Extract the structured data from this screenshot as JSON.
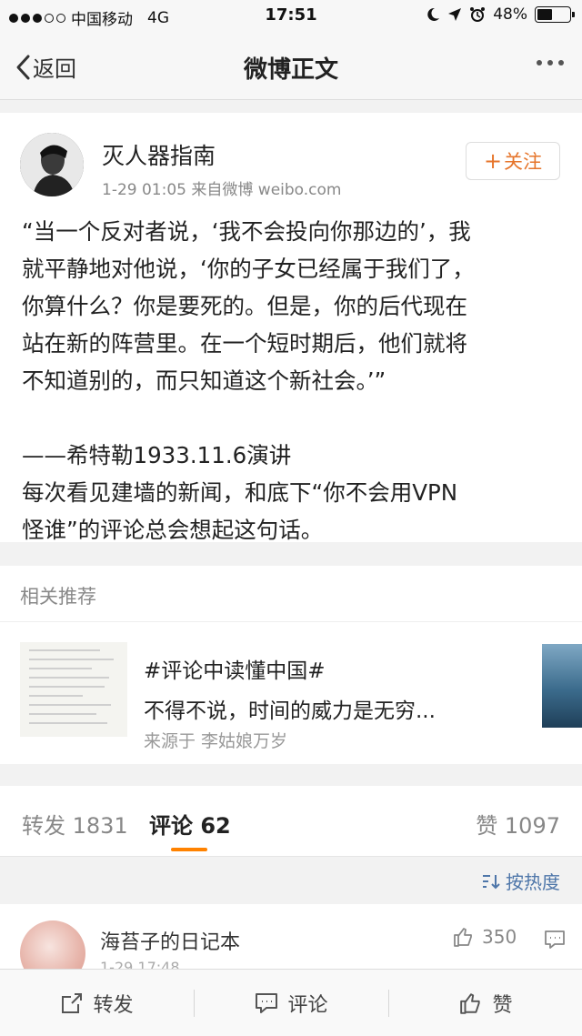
{
  "status_bar": {
    "carrier": "中国移动",
    "network": "4G",
    "time": "17:51",
    "battery_percent": "48%",
    "battery_level": 0.48,
    "signal_bars": 3,
    "signal_total": 5
  },
  "nav": {
    "back_label": "返回",
    "title": "微博正文"
  },
  "post": {
    "author": "灭人器指南",
    "meta": "1-29 01:05  来自微博 weibo.com",
    "follow_label": "关注",
    "lines": [
      "“当一个反对者说，‘我不会投向你那边的’，我",
      "就平静地对他说，‘你的子女已经属于我们了，",
      "你算什么？你是要死的。但是，你的后代现在",
      "站在新的阵营里。在一个短时期后，他们就将",
      "不知道别的，而只知道这个新社会。’”",
      "",
      "——希特勒1933.11.6演讲",
      "每次看见建墙的新闻，和底下“你不会用VPN",
      "怪谁”的评论总会想起这句话。"
    ]
  },
  "related": {
    "header": "相关推荐",
    "title": "#评论中读懂中国#",
    "desc": "不得不说，时间的威力是无穷...",
    "source": "来源于 李姑娘万岁"
  },
  "tabs": {
    "repost": "转发 1831",
    "comment": "评论 62",
    "like": "赞 1097"
  },
  "sort": {
    "label": "按热度"
  },
  "comment": {
    "user": "海苔子的日记本",
    "time": "1-29 17:48",
    "likes": "350"
  },
  "bottom_bar": {
    "repost": "转发",
    "comment": "评论",
    "like": "赞"
  },
  "colors": {
    "accent_orange": "#ff8200",
    "follow_orange": "#e6752b",
    "link_blue": "#4e76a9"
  }
}
